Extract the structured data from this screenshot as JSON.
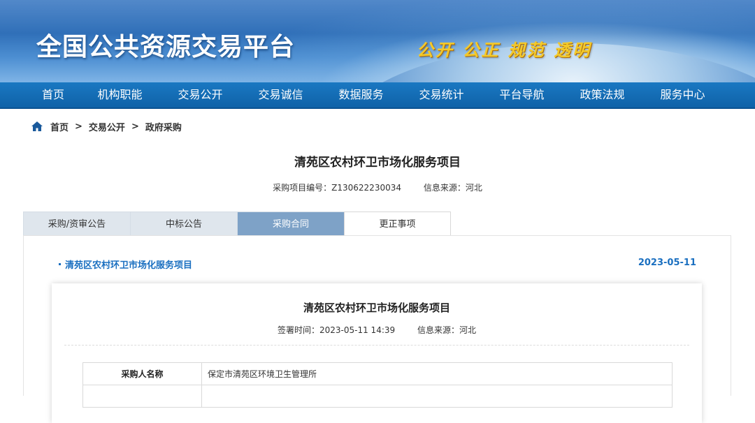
{
  "header": {
    "site_title": "全国公共资源交易平台",
    "slogan": "公开 公正 规范 透明"
  },
  "nav": {
    "items": [
      "首页",
      "机构职能",
      "交易公开",
      "交易诚信",
      "数据服务",
      "交易统计",
      "平台导航",
      "政策法规",
      "服务中心"
    ]
  },
  "breadcrumb": {
    "home": "首页",
    "separator": ">",
    "level1": "交易公开",
    "level2": "政府采购"
  },
  "project": {
    "title": "清苑区农村环卫市场化服务项目",
    "code_text": "采购项目编号：Z130622230034",
    "source_text": "信息来源：河北"
  },
  "tabs": {
    "items": [
      "采购/资审公告",
      "中标公告",
      "采购合同",
      "更正事项"
    ],
    "active": "采购合同"
  },
  "list": {
    "item_title": "清苑区农村环卫市场化服务项目",
    "item_date": "2023-05-11"
  },
  "detail": {
    "title": "清苑区农村环卫市场化服务项目",
    "sign_time_text": "签署时间：2023-05-11 14:39",
    "source_text": "信息来源：河北",
    "rows": [
      {
        "label": "采购人名称",
        "value": "保定市清苑区环境卫生管理所"
      }
    ]
  },
  "colors": {
    "nav_bg": "#0f62a8",
    "active_tab": "#7ea2c7",
    "link_blue": "#1a6fc0",
    "slogan_gold": "#f3c92a"
  }
}
